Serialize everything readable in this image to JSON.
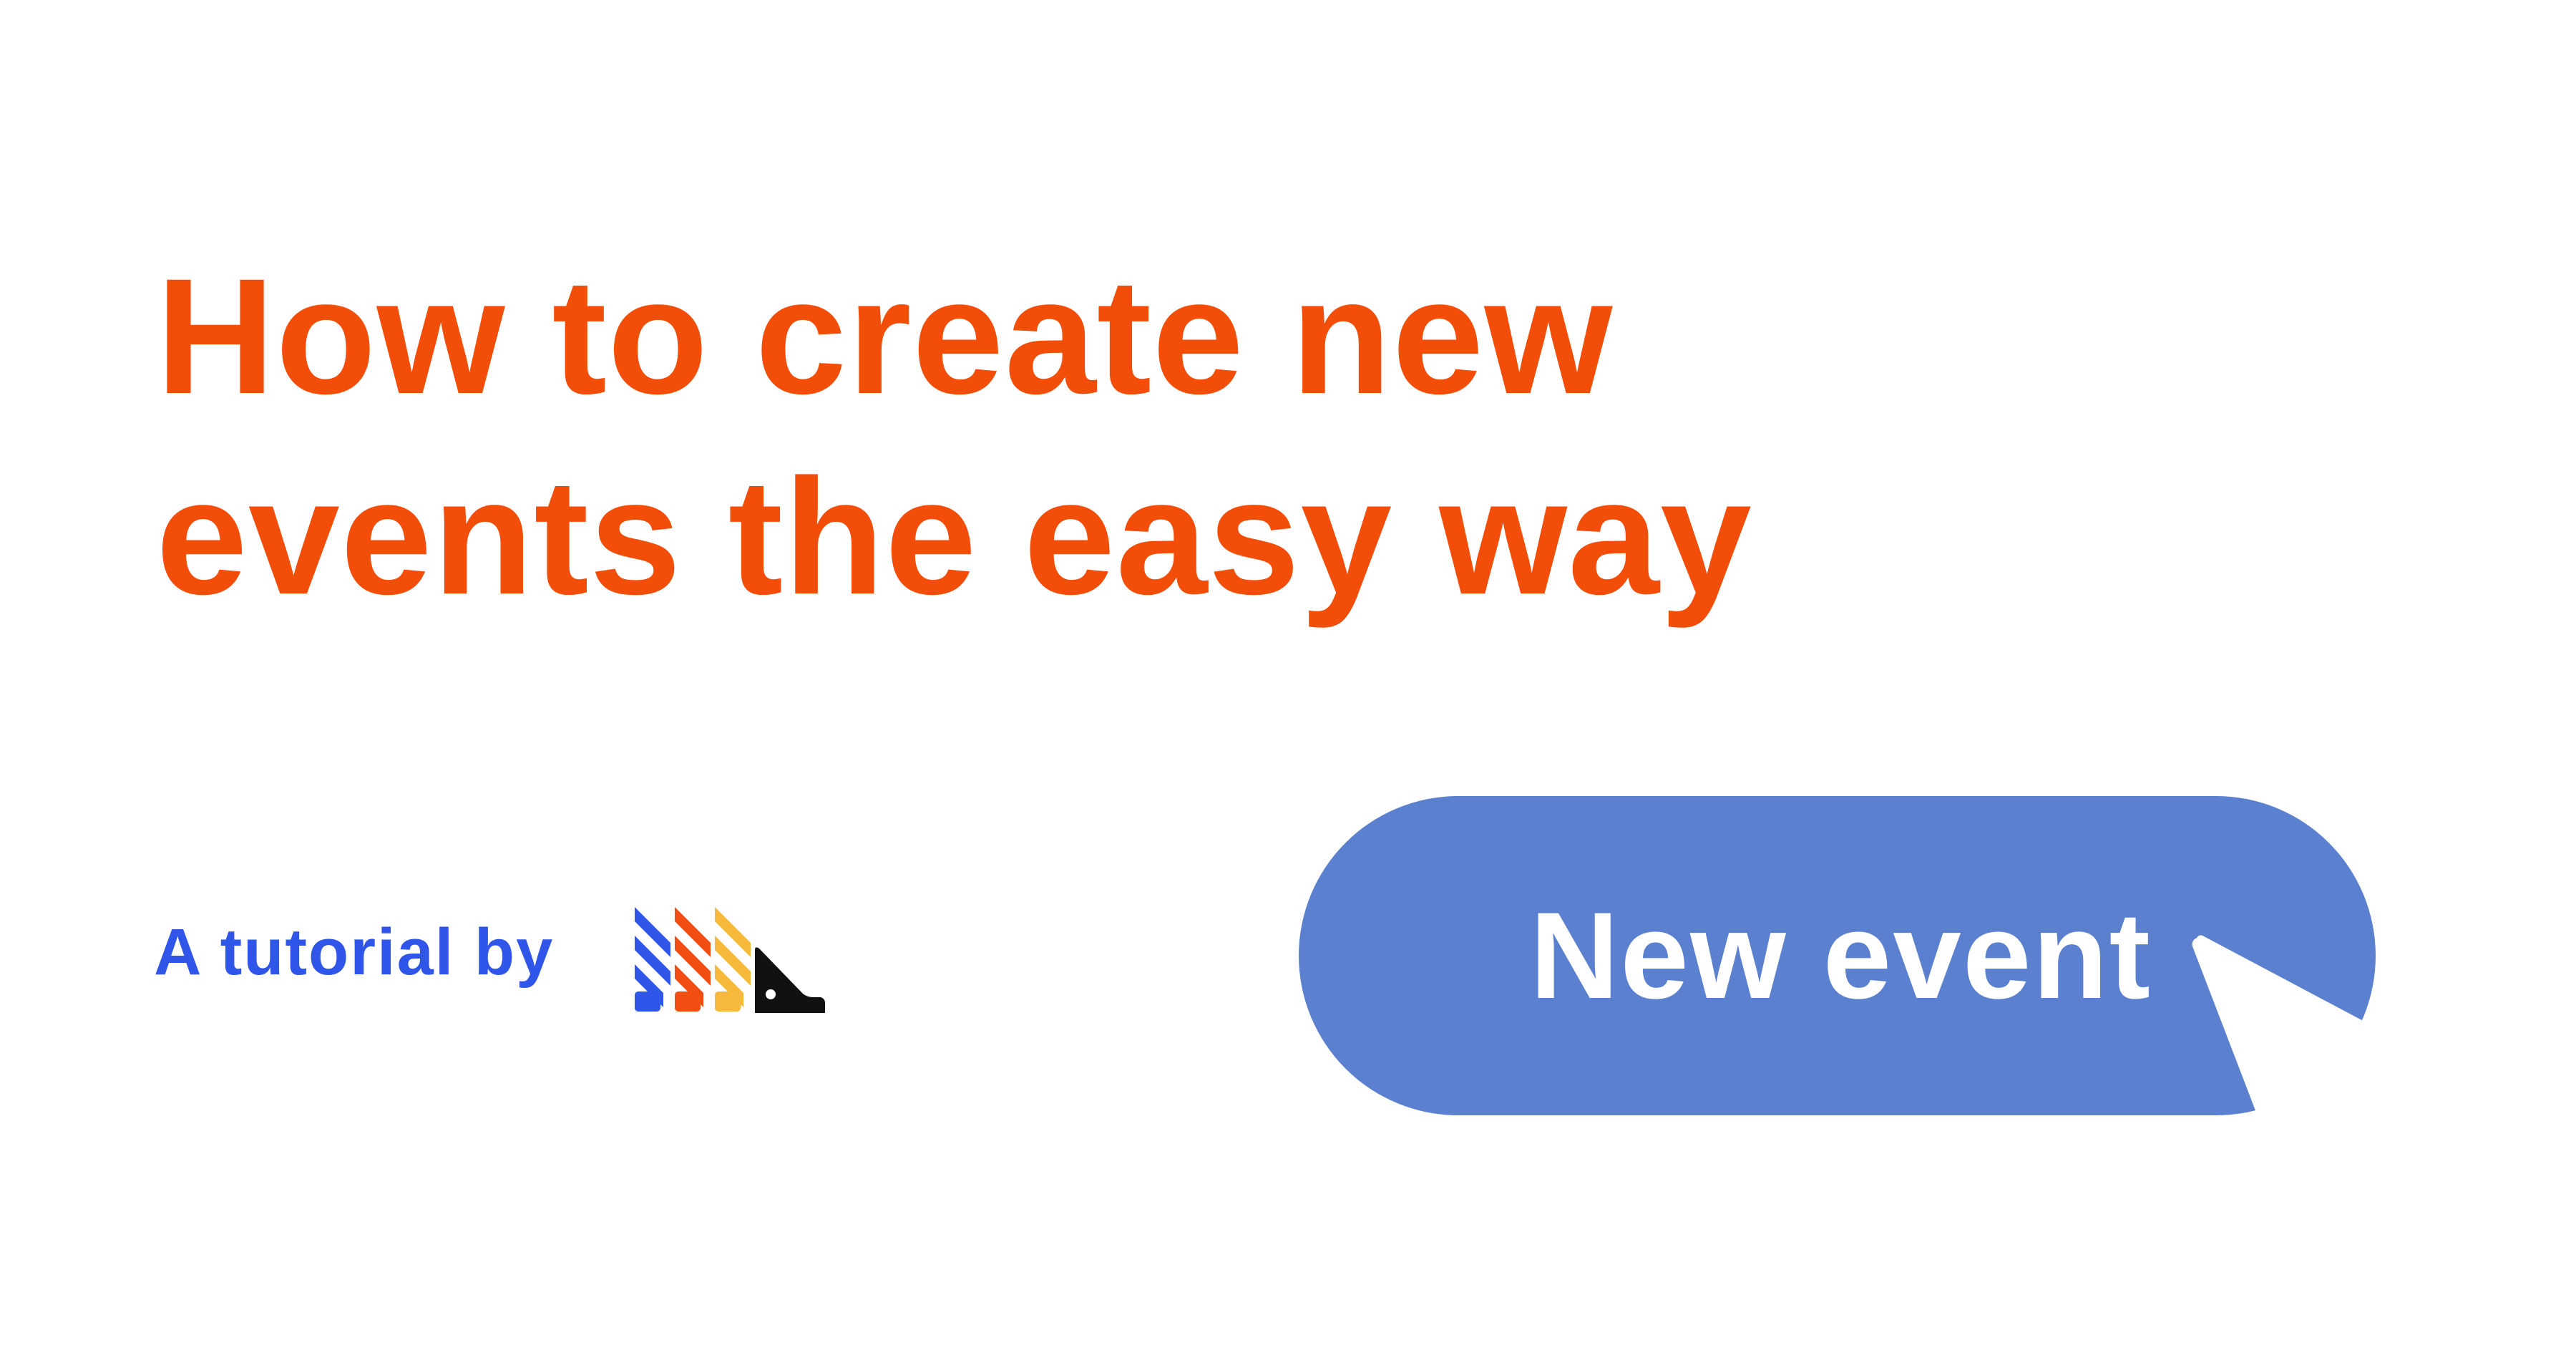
{
  "headline": {
    "line1": "How to create new",
    "line2": "events the easy way"
  },
  "byline": {
    "text": "A tutorial by"
  },
  "logo": {
    "icon": "striped-blocks-logo-icon",
    "colors": [
      "#2F56E8",
      "#F24E12",
      "#F6B93B",
      "#111111"
    ]
  },
  "cta": {
    "label": "New event"
  },
  "cursor": {
    "icon": "mouse-pointer-icon"
  },
  "colors": {
    "background": "#FFFFFF",
    "headline": "#F24E0A",
    "byline": "#2F56E8",
    "button": "#5A80CF",
    "button_text": "#FFFFFF",
    "cursor_fill": "#FFFFFF"
  }
}
